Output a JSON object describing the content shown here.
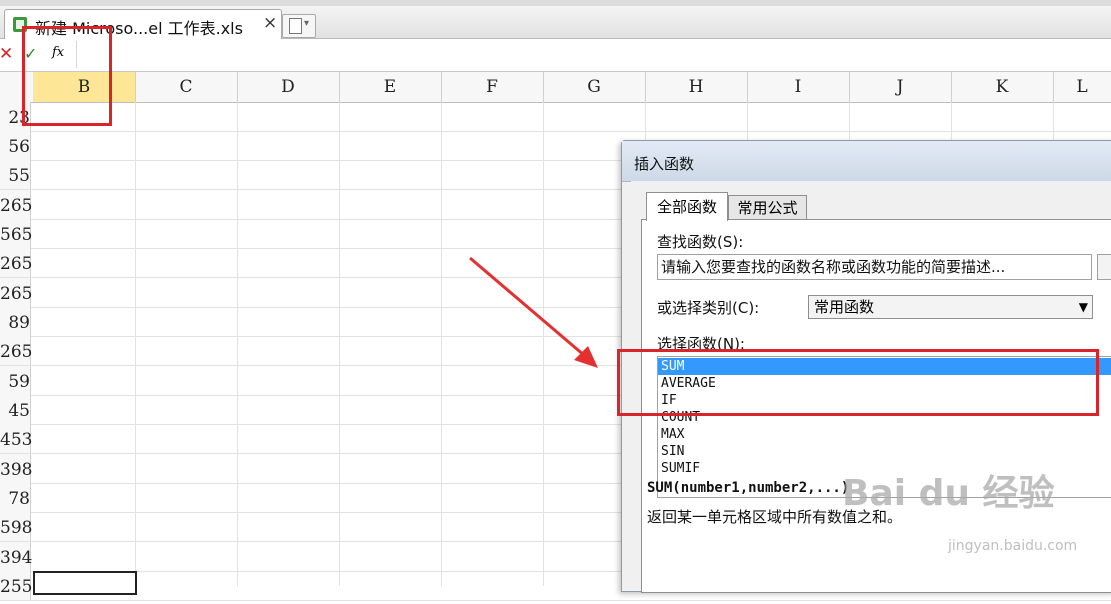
{
  "document_tab": {
    "title": "新建 Microso...el 工作表.xls",
    "close": "×"
  },
  "formula_bar": {
    "cancel": "✕",
    "confirm": "✓",
    "fx": "fx"
  },
  "columns": [
    "B",
    "C",
    "D",
    "E",
    "F",
    "G",
    "H",
    "I",
    "J",
    "K",
    "L"
  ],
  "selected_column": "B",
  "rows": [
    "23",
    "56",
    "55",
    "265",
    "565",
    "265",
    "265",
    "89",
    "265",
    "59",
    "45",
    "453",
    "398",
    "78",
    "598",
    "394",
    "255"
  ],
  "dialog": {
    "title": "插入函数",
    "tabs": [
      "全部函数",
      "常用公式"
    ],
    "search_label": "查找函数(S):",
    "search_placeholder": "请输入您要查找的函数名称或函数功能的简要描述...",
    "category_label": "或选择类别(C):",
    "category_value": "常用函数",
    "function_label": "选择函数(N):",
    "functions": [
      "SUM",
      "AVERAGE",
      "IF",
      "COUNT",
      "MAX",
      "SIN",
      "SUMIF"
    ],
    "selected_function": "SUM",
    "syntax": "SUM(number1,number2,...)",
    "description": "返回某一单元格区域中所有数值之和。"
  },
  "watermark": {
    "brand": "Bai du 经验",
    "url": "jingyan.baidu.com"
  },
  "colors": {
    "annotation": "#d9252a",
    "selection": "#3399ff",
    "column_highlight": "#fde796"
  }
}
